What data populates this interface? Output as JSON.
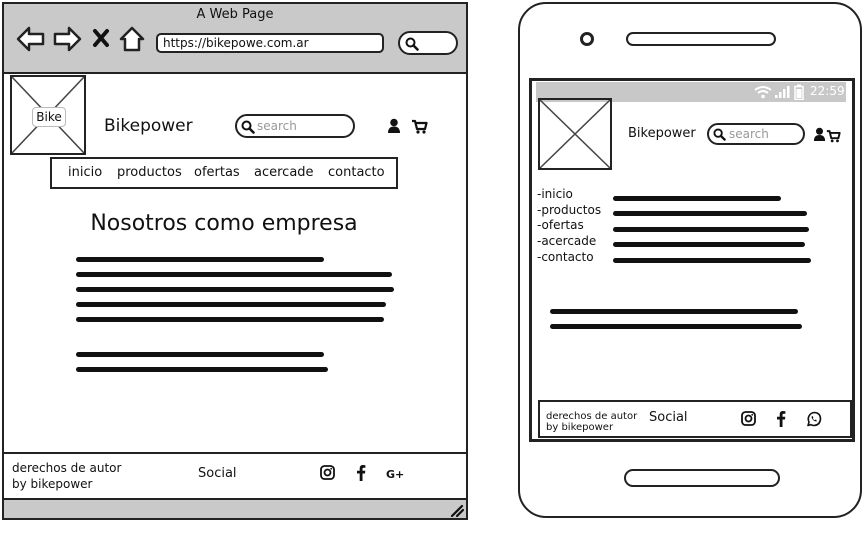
{
  "desktop": {
    "window_title": "A Web Page",
    "url": "https://bikepowe.com.ar",
    "logo_label": "Bike",
    "brand": "Bikepower",
    "search_placeholder": "search",
    "menu": [
      "inicio",
      "productos",
      "ofertas",
      "acercade",
      "contacto"
    ],
    "heading": "Nosotros como empresa",
    "footer": {
      "copyright_line1": "derechos de autor",
      "copyright_line2": "by bikepower",
      "social_label": "Social",
      "social_icons": [
        "instagram-icon",
        "facebook-icon",
        "google-plus-icon"
      ],
      "google_plus_text": "G+"
    },
    "header_icons": [
      "user-icon",
      "cart-icon"
    ]
  },
  "mobile": {
    "status_time": "22:59",
    "brand": "Bikepower",
    "search_placeholder": "search",
    "nav": [
      "-inicio",
      "-productos",
      "-ofertas",
      "-acercade",
      "-contacto"
    ],
    "footer": {
      "copyright_line1": "derechos de autor",
      "copyright_line2": "by bikepower",
      "social_label": "Social",
      "social_icons": [
        "instagram-icon",
        "facebook-icon",
        "whatsapp-icon"
      ]
    }
  }
}
